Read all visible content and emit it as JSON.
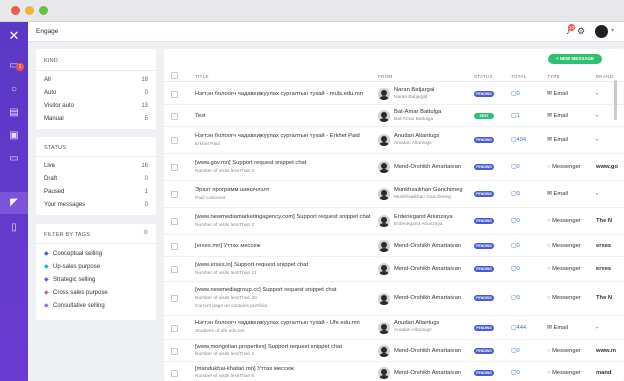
{
  "topbar": {
    "title": "Engage",
    "bell_count": "10"
  },
  "kind": {
    "heading": "KIND",
    "items": [
      {
        "label": "All",
        "count": "18"
      },
      {
        "label": "Auto",
        "count": "0"
      },
      {
        "label": "Visitor auto",
        "count": "13"
      },
      {
        "label": "Manual",
        "count": "5"
      }
    ]
  },
  "status_panel": {
    "heading": "STATUS",
    "items": [
      {
        "label": "Live",
        "count": "16"
      },
      {
        "label": "Draft",
        "count": "0"
      },
      {
        "label": "Paused",
        "count": "1"
      },
      {
        "label": "Your messages",
        "count": "0"
      }
    ]
  },
  "tags": {
    "heading": "FILTER BY TAGS",
    "items": [
      {
        "label": "Conceptual selling",
        "color": "#4a5bd4"
      },
      {
        "label": "Up-sales purpose",
        "color": "#2fa6c9"
      },
      {
        "label": "Strategic selling",
        "color": "#7c54db"
      },
      {
        "label": "Cross sales purpose",
        "color": "#e05aa0"
      },
      {
        "label": "Consultative selling",
        "color": "#9b6be0"
      }
    ]
  },
  "main": {
    "new_message_label": "+ NEW MESSAGE",
    "columns": {
      "title": "TITLE",
      "from": "FROM",
      "status": "STATUS",
      "total": "TOTAL",
      "type": "TYPE",
      "brand": "BRAND"
    },
    "rows": [
      {
        "title": "Нэгтэн болоогч чадавхижуулах сургалтын тухай - muls.edu.mn",
        "sub": "",
        "sub2": "",
        "from": "Naran Batjargal",
        "from2": "Naran Batjargal",
        "status": "PENDING",
        "total": "0",
        "type": "Email",
        "brand": "-"
      },
      {
        "title": "Test",
        "sub": "",
        "sub2": "",
        "from": "Bat-Amar Battulga",
        "from2": "Bat-Amar Battulga",
        "status": "SENT",
        "total": "1",
        "type": "Email",
        "brand": "-"
      },
      {
        "title": "Нэгтэн болоогч чадавхижуулах сургалтын тухай - Erkhet Paid",
        "sub": "Erkhet Paid",
        "sub2": "",
        "from": "Anudari Altantugs",
        "from2": "Anudari Altantugs",
        "status": "PENDING",
        "total": "494",
        "type": "Email",
        "brand": "-"
      },
      {
        "title": "[www.gov.mn] Support request snippet chat",
        "sub": "Number of visits lessThan 3",
        "sub2": "",
        "from": "Mend-Orshikh Amartaivan",
        "from2": "",
        "status": "PENDING",
        "total": "0",
        "type": "Messenger",
        "brand": "www.go"
      },
      {
        "title": "Эрхэт программ шинэчлэлт",
        "sub": "Paid customer",
        "sub2": "",
        "from": "Munkhsaikhan Ganchimeg",
        "from2": "Munkhsaikhan Ganchimeg",
        "status": "PENDING",
        "total": "0",
        "type": "Email",
        "brand": "-"
      },
      {
        "title": "[www.newmediamarketingagency.com] Support request snippet chat",
        "sub": "Number of visits lessThan 3",
        "sub2": "",
        "from": "Erdenegarid Ariunzaya",
        "from2": "Erdenegarid Ariunzaya",
        "status": "PENDING",
        "total": "0",
        "type": "Messenger",
        "brand": "The N"
      },
      {
        "title": "[erxes.mn] Уттах мессеж",
        "sub": "",
        "sub2": "",
        "from": "Mend-Orshikh Amartaivan",
        "from2": "",
        "status": "PENDING",
        "total": "0",
        "type": "Messenger",
        "brand": "erxes"
      },
      {
        "title": "[www.erxes.io] Support request snippet chat",
        "sub": "Number of visits lessThan 11",
        "sub2": "",
        "from": "Mend-Orshikh Amartaivan",
        "from2": "",
        "status": "PENDING",
        "total": "0",
        "type": "Messenger",
        "brand": "erxes"
      },
      {
        "title": "[www.newmediagroup.cc] Support request snippet chat",
        "sub": "Number of visits lessThan 20",
        "sub2": "Current page url contains portfolio",
        "from": "Mend-Orshikh Amartaivan",
        "from2": "",
        "status": "PENDING",
        "total": "0",
        "type": "Messenger",
        "brand": "The N"
      },
      {
        "title": "Нэгтэн болоогч чадавхижуулах сургалтын тухай - Ufe.edu.mn",
        "sub": "Students of ufe.edu.mn",
        "sub2": "",
        "from": "Anudari Altantugs",
        "from2": "Anudari Altantugs",
        "status": "PENDING",
        "total": "444",
        "type": "Email",
        "brand": "-"
      },
      {
        "title": "[www.mongolian.properties] Support request snippet chat",
        "sub": "Number of visits lessThan 3",
        "sub2": "",
        "from": "Mend-Orshikh Amartaivan",
        "from2": "",
        "status": "PENDING",
        "total": "0",
        "type": "Messenger",
        "brand": "www.m"
      },
      {
        "title": "[mandukhai-khatan.mn] Уттах мессеж",
        "sub": "Number of visits lessThan 6",
        "sub2": "",
        "from": "Mend-Orshikh Amartaivan",
        "from2": "",
        "status": "PENDING",
        "total": "0",
        "type": "Messenger",
        "brand": "mand"
      }
    ]
  },
  "icons": [
    "logo-x-icon",
    "inbox-icon",
    "refresh-icon",
    "dashboard-icon",
    "briefcase-icon",
    "monitor-icon",
    "megaphone-icon",
    "clipboard-icon",
    "bell-icon",
    "gear-icon",
    "chevron-down-icon",
    "email-icon",
    "messenger-icon",
    "tag-icon",
    "filter-icon"
  ]
}
